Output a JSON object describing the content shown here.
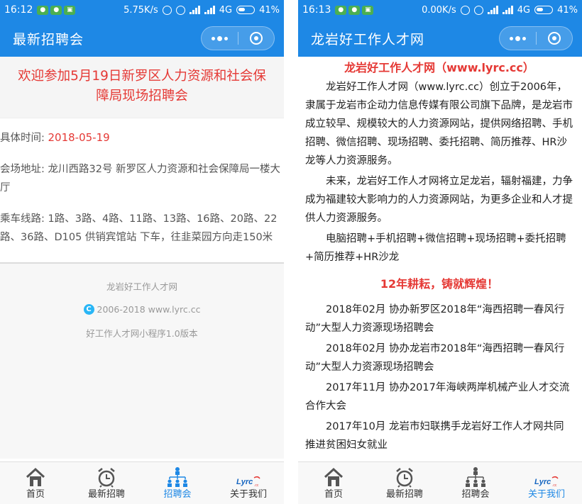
{
  "left": {
    "status": {
      "time": "16:12",
      "speed": "5.75K/s",
      "network": "4G",
      "battery": "41%"
    },
    "title": "最新招聘会",
    "banner": "欢迎参加5月19日新罗区人力资源和社会保障局现场招聘会",
    "details": {
      "time_label": "具体时间:",
      "time_value": "2018-05-19",
      "venue": "会场地址: 龙川西路32号 新罗区人力资源和社会保障局一楼大厅",
      "bus": "乘车线路: 1路、3路、4路、11路、13路、16路、20路、22路、36路、D105 供销宾馆站 下车，往韭菜园方向走150米"
    },
    "footer": {
      "site": "龙岩好工作人才网",
      "copyright": "2006-2018 www.lyrc.cc",
      "version": "好工作人才网小程序1.0版本"
    },
    "active_tab": 2
  },
  "right": {
    "status": {
      "time": "16:13",
      "speed": "0.00K/s",
      "network": "4G",
      "battery": "41%"
    },
    "title": "龙岩好工作人才网",
    "article": {
      "heading": "龙岩好工作人才网（www.lyrc.cc）",
      "p1": "龙岩好工作人才网（www.lyrc.cc）创立于2006年，隶属于龙岩市企动力信息传媒有限公司旗下品牌，是龙岩市成立较早、规模较大的人力资源网站，提供网络招聘、手机招聘、微信招聘、现场招聘、委托招聘、简历推荐、HR沙龙等人力资源服务。",
      "p2": "未来，龙岩好工作人才网将立足龙岩，辐射福建，力争成为福建较大影响力的人力资源网站，为更多企业和人才提供人力资源服务。",
      "p3": "电脑招聘+手机招聘+微信招聘+现场招聘+委托招聘+简历推荐+HR沙龙",
      "subheading": "12年耕耘，铸就辉煌！",
      "e1": "2018年02月 协办新罗区2018年“海西招聘一春风行动”大型人力资源现场招聘会",
      "e2": "2018年02月 协办龙岩市2018年“海西招聘一春风行动”大型人力资源现场招聘会",
      "e3": "2017年11月 协办2017年海峡两岸机械产业人才交流合作大会",
      "e4": "2017年10月 龙岩市妇联携手龙岩好工作人才网共同推进贫困妇女就业"
    },
    "active_tab": 3
  },
  "tabs": [
    {
      "label": "首页",
      "icon": "home-icon"
    },
    {
      "label": "最新招聘",
      "icon": "alarm-clock-icon"
    },
    {
      "label": "招聘会",
      "icon": "org-chart-icon"
    },
    {
      "label": "关于我们",
      "icon": "lyrc-logo-icon"
    }
  ],
  "colors": {
    "brand_blue": "#1e88e5",
    "accent_red": "#e53935"
  }
}
